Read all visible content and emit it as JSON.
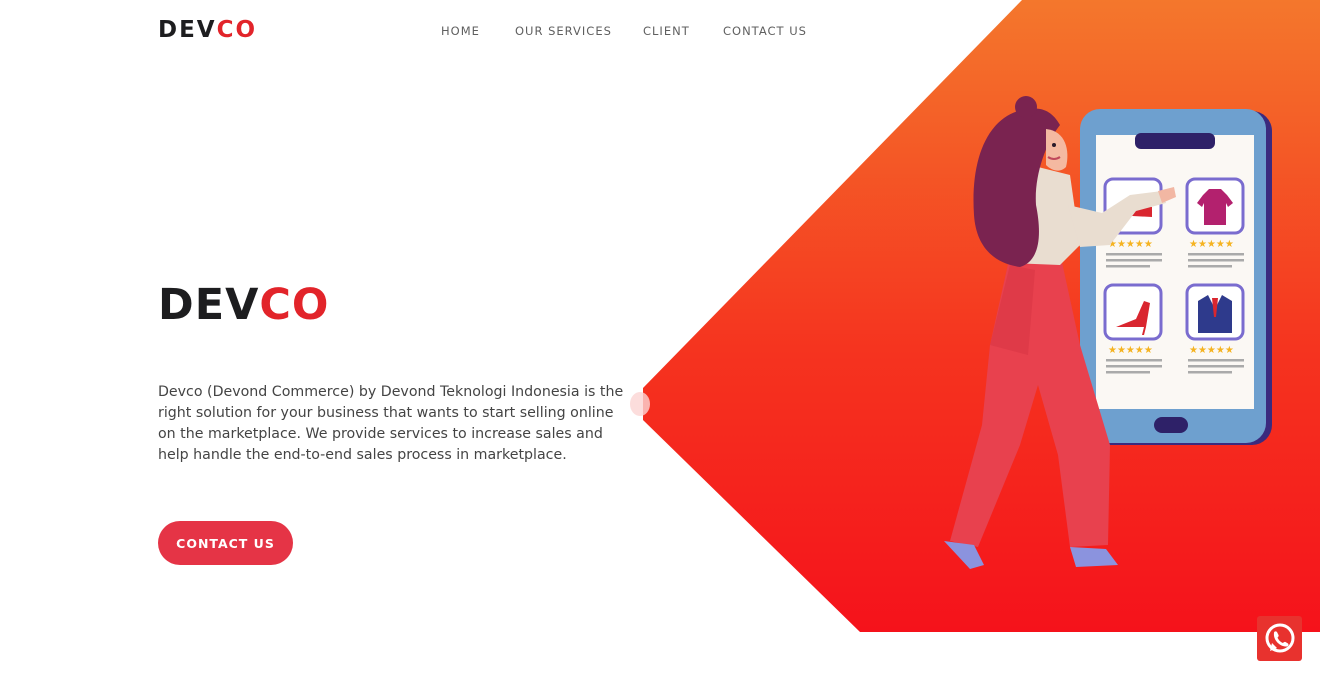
{
  "brand": {
    "prefix": "DEV",
    "suffix": "CO",
    "accent_color": "#e2242a"
  },
  "nav": {
    "items": [
      {
        "label": "HOME"
      },
      {
        "label": "OUR SERVICES"
      },
      {
        "label": "CLIENT"
      },
      {
        "label": "CONTACT US"
      }
    ]
  },
  "hero": {
    "title_prefix": "DEV",
    "title_suffix": "CO",
    "description": "Devco (Devond Commerce) by Devond Teknologi Indonesia is the right solution for your business that wants to start selling online on the marketplace. We provide services to increase sales and help handle the end-to-end sales process in marketplace.",
    "cta_label": "CONTACT US",
    "cta_color": "#e53446",
    "gradient_colors": [
      "#f4772c",
      "#f5121b"
    ]
  },
  "illustration": {
    "icon": "woman-shopping-phone-illustration",
    "product_icons": [
      "shoe-icon",
      "shirt-icon",
      "high-heel-icon",
      "suit-icon"
    ],
    "rating_stars": 5
  },
  "whatsapp": {
    "icon": "whatsapp-icon",
    "color": "#e8322e"
  }
}
